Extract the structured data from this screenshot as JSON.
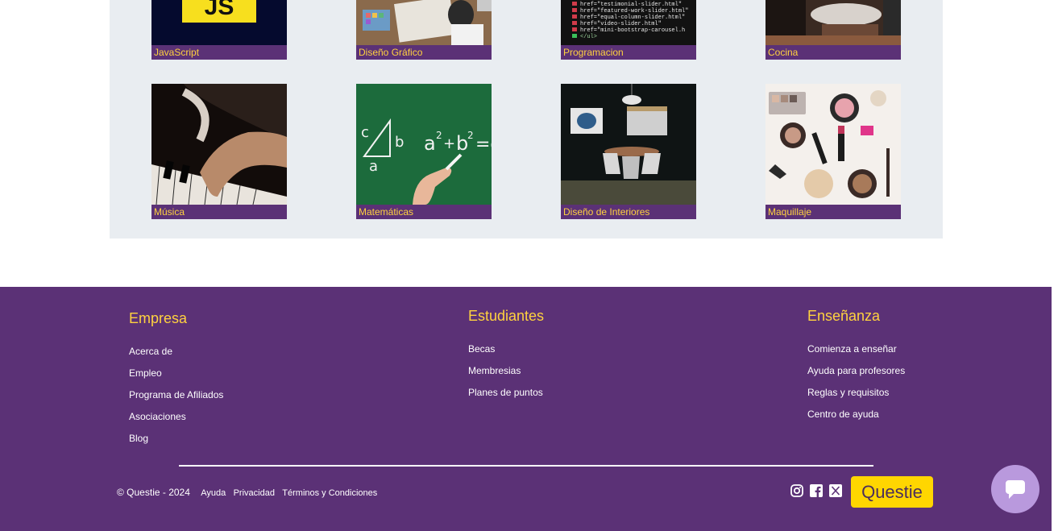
{
  "categories": [
    {
      "label": "JavaScript",
      "image": "javascript-logo"
    },
    {
      "label": "Diseño Gráfico",
      "image": "designer-desk-photo"
    },
    {
      "label": "Programacion",
      "image": "code-screen-photo"
    },
    {
      "label": "Cocina",
      "image": "kitchen-photo"
    },
    {
      "label": "Música",
      "image": "piano-photo"
    },
    {
      "label": "Matemáticas",
      "image": "chalkboard-math-photo"
    },
    {
      "label": "Diseño de Interiores",
      "image": "dining-room-photo"
    },
    {
      "label": "Maquillaje",
      "image": "makeup-flatlay-photo"
    }
  ],
  "footer": {
    "columns": [
      {
        "title": "Empresa",
        "links": [
          "Acerca de",
          "Empleo",
          "Programa de Afiliados",
          "Asociaciones",
          "Blog"
        ]
      },
      {
        "title": "Estudiantes",
        "links": [
          "Becas",
          "Membresias",
          "Planes de puntos"
        ]
      },
      {
        "title": "Enseñanza",
        "links": [
          "Comienza a enseñar",
          "Ayuda para profesores",
          "Reglas y requisitos",
          "Centro de ayuda"
        ]
      }
    ],
    "copyright": "© Questie - 2024",
    "legal_links": [
      "Ayuda",
      "Privacidad",
      "Términos y Condiciones"
    ],
    "socials": [
      "instagram-icon",
      "facebook-icon",
      "x-icon"
    ],
    "brand_button": "Questie"
  },
  "colors": {
    "purple": "#5b3176",
    "yellow": "#ffd23f",
    "panel": "#e9edf1",
    "chat": "#b999dd"
  }
}
